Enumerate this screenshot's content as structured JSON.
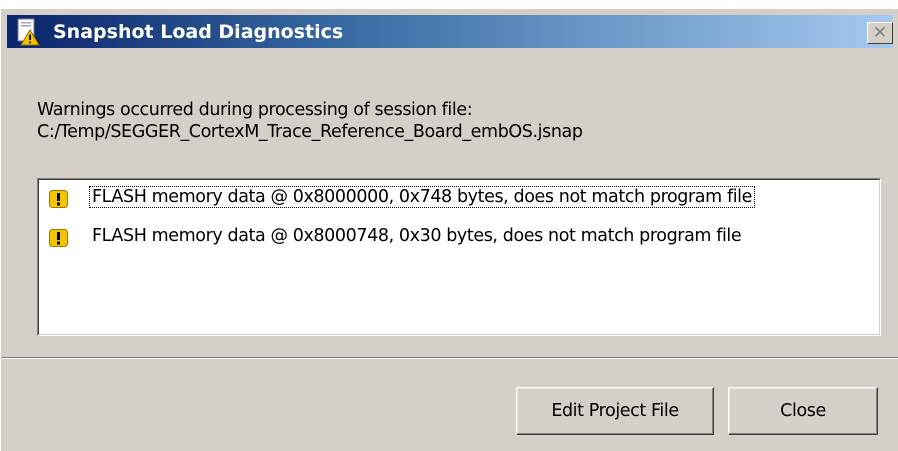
{
  "window": {
    "title": "Snapshot Load Diagnostics",
    "title_icon": "warning-document-icon",
    "close_glyph": "✕"
  },
  "message": {
    "line1": "Warnings occurred during processing of session file:",
    "line2": "C:/Temp/SEGGER_CortexM_Trace_Reference_Board_embOS.jsnap"
  },
  "warnings": [
    {
      "icon": "warning-icon",
      "text": "FLASH memory data @ 0x8000000, 0x748 bytes,  does not match program file"
    },
    {
      "icon": "warning-icon",
      "text": "FLASH memory data @ 0x8000748, 0x30 bytes,  does not match program file"
    }
  ],
  "buttons": {
    "edit_project": "Edit Project File",
    "close": "Close"
  },
  "colors": {
    "dialog_bg": "#d4d0c8",
    "title_start": "#0a246a",
    "title_end": "#a6caf0",
    "warning_yellow": "#f5c400"
  }
}
